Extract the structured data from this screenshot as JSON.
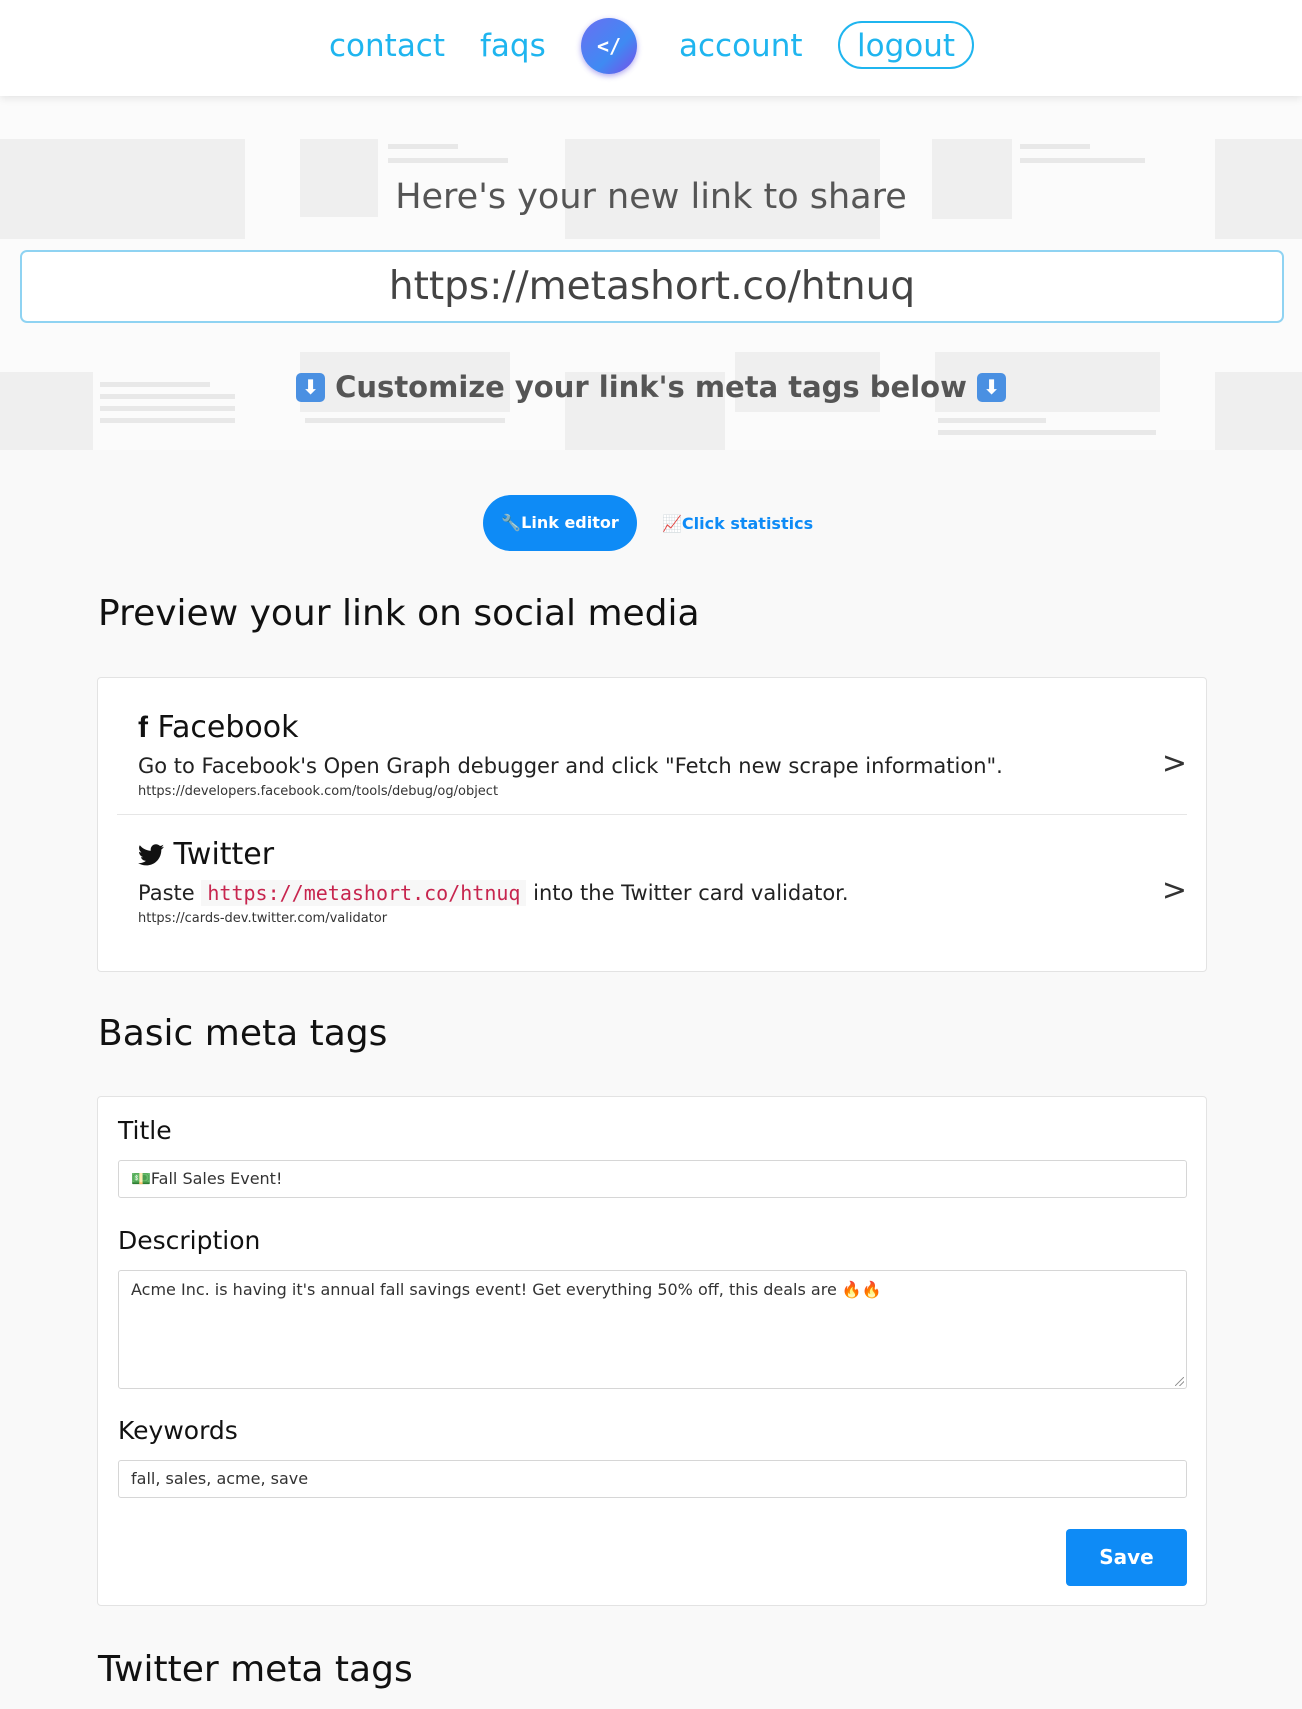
{
  "nav": {
    "contact": "contact",
    "faqs": "faqs",
    "logo_glyph": "</",
    "account": "account",
    "logout": "logout"
  },
  "hero": {
    "title": "Here's your new link to share",
    "short_link": "https://metashort.co/htnuq",
    "customize": "Customize your link's meta tags below",
    "arrow_icon": "down-arrow-icon"
  },
  "tabs": {
    "link_editor": "🔧Link editor",
    "click_statistics": "📈Click statistics"
  },
  "preview": {
    "heading": "Preview your link on social media",
    "facebook": {
      "name": "Facebook",
      "description": "Go to Facebook's Open Graph debugger and click \"Fetch new scrape information\".",
      "url": "https://developers.facebook.com/tools/debug/og/object",
      "chevron": ">"
    },
    "twitter": {
      "name": "Twitter",
      "desc_prefix": "Paste",
      "desc_code": "https://metashort.co/htnuq",
      "desc_suffix": "into the Twitter card validator.",
      "url": "https://cards-dev.twitter.com/validator",
      "chevron": ">"
    }
  },
  "basic": {
    "heading": "Basic meta tags",
    "title_label": "Title",
    "title_value": "💵Fall Sales Event!",
    "description_label": "Description",
    "description_value": "Acme Inc. is having it's annual fall savings event! Get everything 50% off, this deals are 🔥🔥",
    "keywords_label": "Keywords",
    "keywords_value": "fall, sales, acme, save",
    "save_label": "Save"
  },
  "twitter_section": {
    "heading": "Twitter meta tags"
  },
  "colors": {
    "accent": "#1fb5ef",
    "primary_button": "#0e8bf6",
    "code_text": "#c7254e"
  }
}
